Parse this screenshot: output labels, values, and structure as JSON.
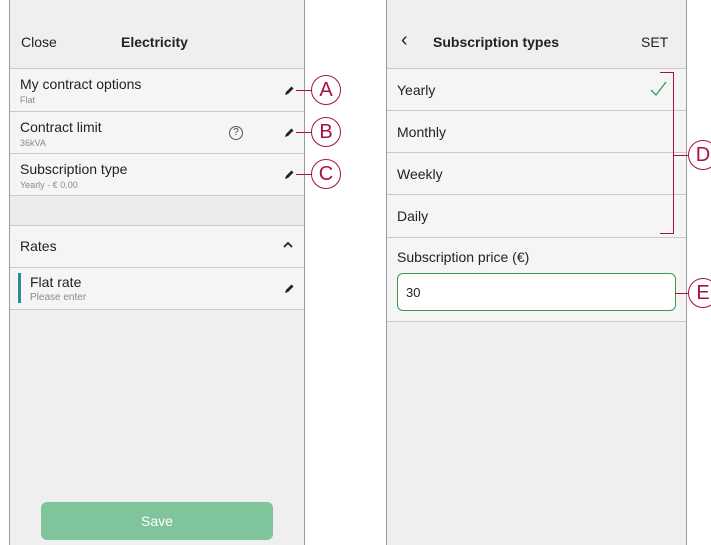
{
  "left": {
    "header": {
      "close": "Close",
      "title": "Electricity"
    },
    "rows": [
      {
        "label": "My contract options",
        "sub": "Flat"
      },
      {
        "label": "Contract limit",
        "sub": "36kVA"
      },
      {
        "label": "Subscription type",
        "sub": "Yearly - € 0.00"
      }
    ],
    "rates": {
      "label": "Rates",
      "chevron": "^",
      "item_label": "Flat rate",
      "item_sub": "Please enter"
    },
    "save_label": "Save"
  },
  "right": {
    "header": {
      "back": "‹",
      "title": "Subscription types",
      "set": "SET"
    },
    "options": [
      "Yearly",
      "Monthly",
      "Weekly",
      "Daily"
    ],
    "selected": "Yearly",
    "price": {
      "label": "Subscription price (€)",
      "value": "30"
    }
  },
  "callouts": {
    "a": "A",
    "b": "B",
    "c": "C",
    "d": "D",
    "e": "E"
  },
  "icons": {
    "help": "?",
    "check": "check-icon",
    "pencil": "pencil-icon"
  },
  "colors": {
    "accent": "#a8123e",
    "save": "#80c49b",
    "input_border": "#3a9a55",
    "rate_bar": "#2c8c92"
  }
}
